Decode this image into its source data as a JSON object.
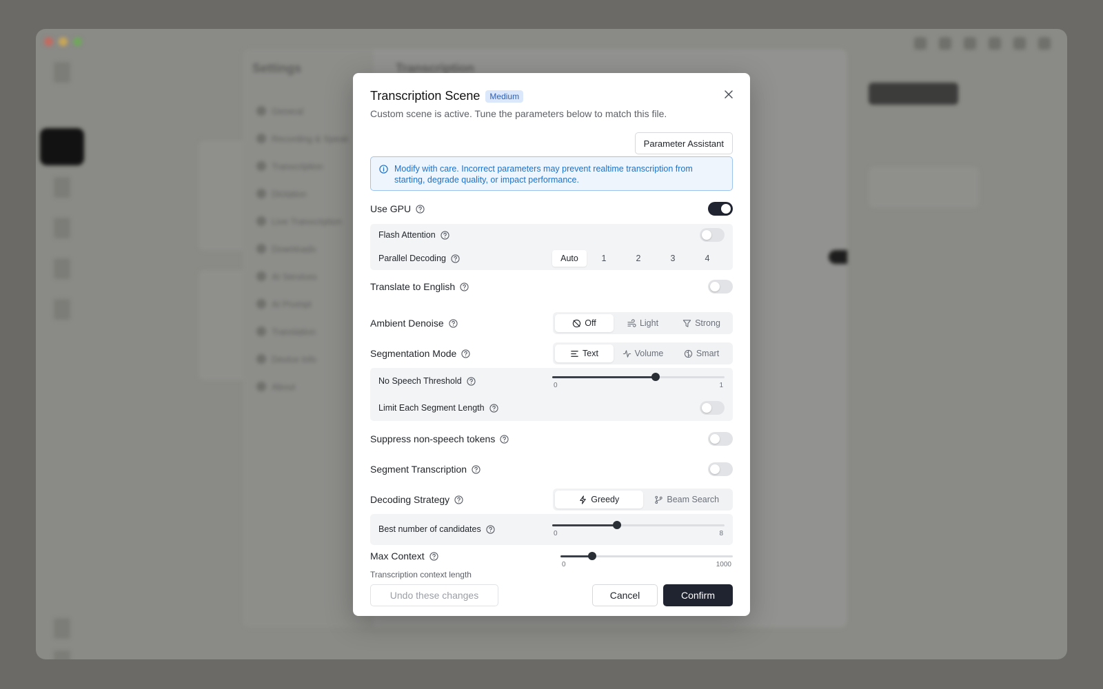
{
  "background": {
    "settings_title": "Settings",
    "settings_nav": [
      "General",
      "Recording & Speak",
      "Transcription",
      "Dictation",
      "Live Transcription",
      "Downloads",
      "AI Services",
      "AI Prompt",
      "Translation",
      "Device Info",
      "About"
    ],
    "main_title": "Transcription"
  },
  "dialog": {
    "title": "Transcription Scene",
    "badge": "Medium",
    "subtitle": "Custom scene is active. Tune the parameters below to match this file.",
    "assistant_button": "Parameter Assistant",
    "info": "Modify with care. Incorrect parameters may prevent realtime transcription from starting, degrade quality, or impact performance.",
    "use_gpu": {
      "label": "Use GPU",
      "on": true
    },
    "flash_attention": {
      "label": "Flash Attention",
      "on": false
    },
    "parallel_decoding": {
      "label": "Parallel Decoding",
      "options": [
        "Auto",
        "1",
        "2",
        "3",
        "4"
      ],
      "selected": "Auto"
    },
    "translate_english": {
      "label": "Translate to English",
      "on": false
    },
    "ambient_denoise": {
      "label": "Ambient Denoise",
      "options": [
        "Off",
        "Light",
        "Strong"
      ],
      "selected": "Off"
    },
    "segmentation_mode": {
      "label": "Segmentation Mode",
      "options": [
        "Text",
        "Volume",
        "Smart"
      ],
      "selected": "Text"
    },
    "no_speech_threshold": {
      "label": "No Speech Threshold",
      "min": "0",
      "max": "1",
      "value": 0.6
    },
    "limit_segment": {
      "label": "Limit Each Segment Length",
      "on": false
    },
    "suppress_tokens": {
      "label": "Suppress non-speech tokens",
      "on": false
    },
    "segment_transcription": {
      "label": "Segment Transcription",
      "on": false
    },
    "decoding_strategy": {
      "label": "Decoding Strategy",
      "options": [
        "Greedy",
        "Beam Search"
      ],
      "selected": "Greedy"
    },
    "best_candidates": {
      "label": "Best number of candidates",
      "min": "0",
      "max": "8",
      "value": 3
    },
    "max_context": {
      "label": "Max Context",
      "sublabel": "Transcription context length",
      "min": "0",
      "max": "1000",
      "value": 185
    },
    "undo_button": "Undo these changes",
    "cancel_button": "Cancel",
    "confirm_button": "Confirm"
  },
  "colors": {
    "accent_dark": "#1f2430",
    "info_blue": "#1f6fc4",
    "badge_bg": "#dbe8fb"
  }
}
